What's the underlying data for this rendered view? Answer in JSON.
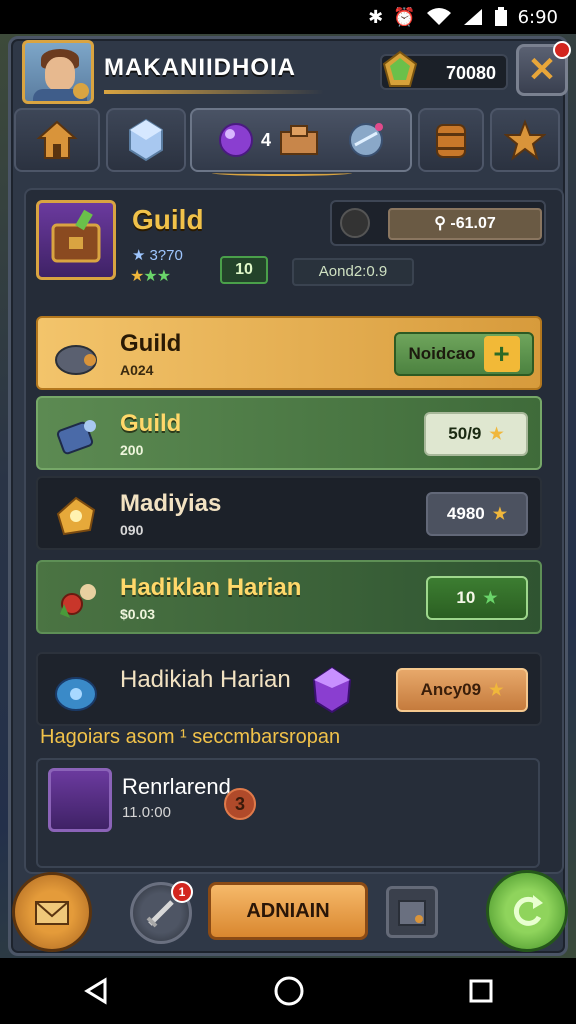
{
  "status": {
    "time": "6:90"
  },
  "header": {
    "player_name": "MAKANIIDHOIA",
    "currency_value": "70080",
    "close_label": "✕"
  },
  "tabs": [
    {
      "icon": "home-icon"
    },
    {
      "icon": "crystal-icon"
    },
    {
      "icon": "purple-orb-icon",
      "count": "4"
    },
    {
      "icon": "sphere-icon"
    },
    {
      "icon": "barrel-icon"
    },
    {
      "icon": "star-icon"
    }
  ],
  "guild": {
    "title": "Guild",
    "rating": "3?70",
    "level": "10",
    "timer": "-61.07",
    "sub": "Aond2:0.9"
  },
  "rows": [
    {
      "title": "Guild",
      "sub": "A024",
      "button": "Noidcao",
      "style": "gold"
    },
    {
      "title": "Guild",
      "sub": "200",
      "button": "50/9",
      "style": "green"
    },
    {
      "title": "Madiyias",
      "sub": "090",
      "button": "4980",
      "style": "dark"
    },
    {
      "title": "Hadiklan Harian",
      "sub": "$0.03",
      "button": "10",
      "style": "darkgreen"
    },
    {
      "title": "Hadikiah Harian",
      "sub": "",
      "button": "Ancy09",
      "style": "darkblue"
    }
  ],
  "section": {
    "label": "Hagoiars asom ¹ seccmbarsropan"
  },
  "reward": {
    "title": "Renrlarend",
    "sub": "11.0:00",
    "badge": "3"
  },
  "bottom": {
    "notification": "1",
    "main_button": "ADNIAIN"
  },
  "colors": {
    "gold": "#f1c24a",
    "green": "#5c8a52",
    "panel": "#2f3847"
  }
}
